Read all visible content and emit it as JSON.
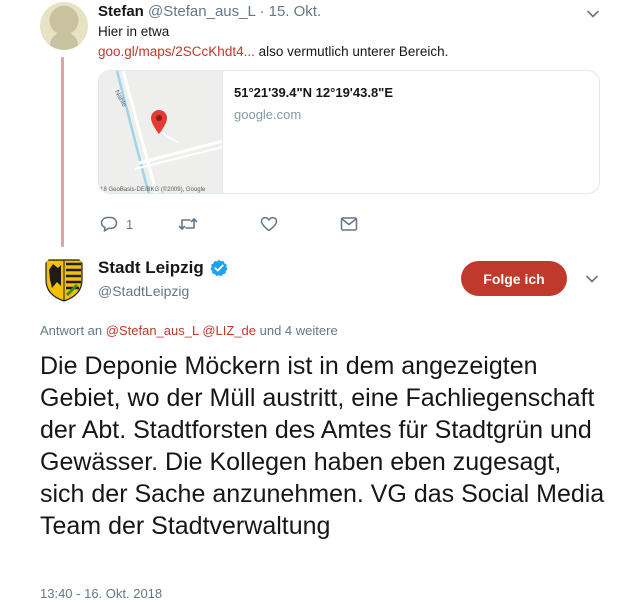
{
  "reply_tweet": {
    "name": "Stefan",
    "handle": "@Stefan_aus_L",
    "separator": "·",
    "date": "15. Okt.",
    "line1": "Hier in etwa",
    "link": "goo.gl/maps/2SCcKhdt4...",
    "line2_rest": " also vermutlich unterer Bereich.",
    "card": {
      "title": "51°21'39.4\"N 12°19'43.8\"E",
      "domain": "google.com",
      "map_road_label": "Nahle",
      "map_copyright": "'18 GeoBasis-DE/BKG (©2009), Google"
    },
    "actions": {
      "reply_count": "1",
      "retweet_count": "",
      "like_count": ""
    }
  },
  "main_tweet": {
    "name": "Stadt Leipzig",
    "handle": "@StadtLeipzig",
    "follow_label": "Folge ich",
    "reply_prefix": "Antwort an ",
    "reply_mention1": "@Stefan_aus_L",
    "reply_mention2": "@LIZ_de",
    "reply_suffix": " und 4 weitere",
    "text": "Die Deponie Möckern ist in dem angezeigten Gebiet, wo der Müll austritt, eine Fachliegenschaft der Abt. Stadtforsten des Amtes für Stadtgrün und Gewässer. Die Kollegen haben eben zugesagt, sich der Sache anzunehmen. VG das Social Media Team der Stadtverwaltung",
    "timestamp": "13:40 - 16. Okt. 2018"
  },
  "colors": {
    "accent": "#c0392b",
    "thread_line": "#d9a5a5",
    "muted": "#657786",
    "verified": "#1da1f2"
  },
  "icons": {
    "reply": "comment-bubble-icon",
    "retweet": "retweet-icon",
    "like": "heart-icon",
    "dm": "envelope-icon",
    "menu": "chevron-down-icon",
    "verified": "verified-badge-icon",
    "map_pin": "map-pin-icon"
  }
}
